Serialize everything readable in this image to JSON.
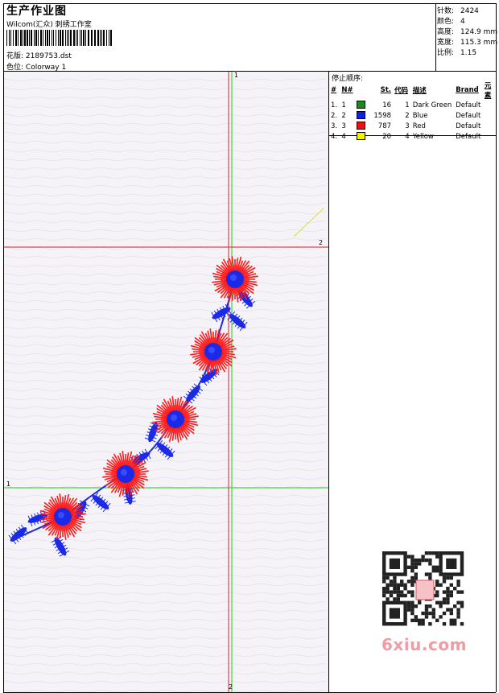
{
  "header": {
    "title": "生产作业图",
    "studio": "Wilcom(汇众) 刺绣工作室",
    "pattern_label": "花版:",
    "pattern_file": "2189753.dst",
    "colorway_label": "色位:",
    "colorway": "Colorway 1"
  },
  "stats": {
    "stitches_label": "针数:",
    "stitches": "2424",
    "colors_label": "颜色:",
    "colors": "4",
    "height_label": "高度:",
    "height": "124.9 mm",
    "width_label": "宽度:",
    "width": "115.3 mm",
    "scale_label": "比例:",
    "scale": "1.15"
  },
  "stop_sequence": {
    "title": "停止顺序:",
    "headers": {
      "idx": "#",
      "no": "N#",
      "stitches": "St.",
      "code": "代码",
      "desc": "描述",
      "brand": "Brand",
      "element": "元素"
    },
    "rows": [
      {
        "idx": "1.",
        "no": "1",
        "color": "#1a8a1a",
        "stitches": "16",
        "code": "1",
        "desc": "Dark Green",
        "brand": "Default"
      },
      {
        "idx": "2.",
        "no": "2",
        "color": "#1020e0",
        "stitches": "1598",
        "code": "2",
        "desc": "Blue",
        "brand": "Default"
      },
      {
        "idx": "3.",
        "no": "3",
        "color": "#ee1111",
        "stitches": "787",
        "code": "3",
        "desc": "Red",
        "brand": "Default"
      },
      {
        "idx": "4.",
        "no": "4",
        "color": "#f5f000",
        "stitches": "20",
        "code": "4",
        "desc": "Yellow",
        "brand": "Default"
      }
    ]
  },
  "canvas": {
    "marker_green": "1",
    "marker_red": "2",
    "colors": {
      "green_guide": "#22cc22",
      "red_guide": "#dd2222",
      "flower_red": "#ff1a1a",
      "flower_blue": "#1a2ae6"
    }
  },
  "watermark": "6xiu.com"
}
